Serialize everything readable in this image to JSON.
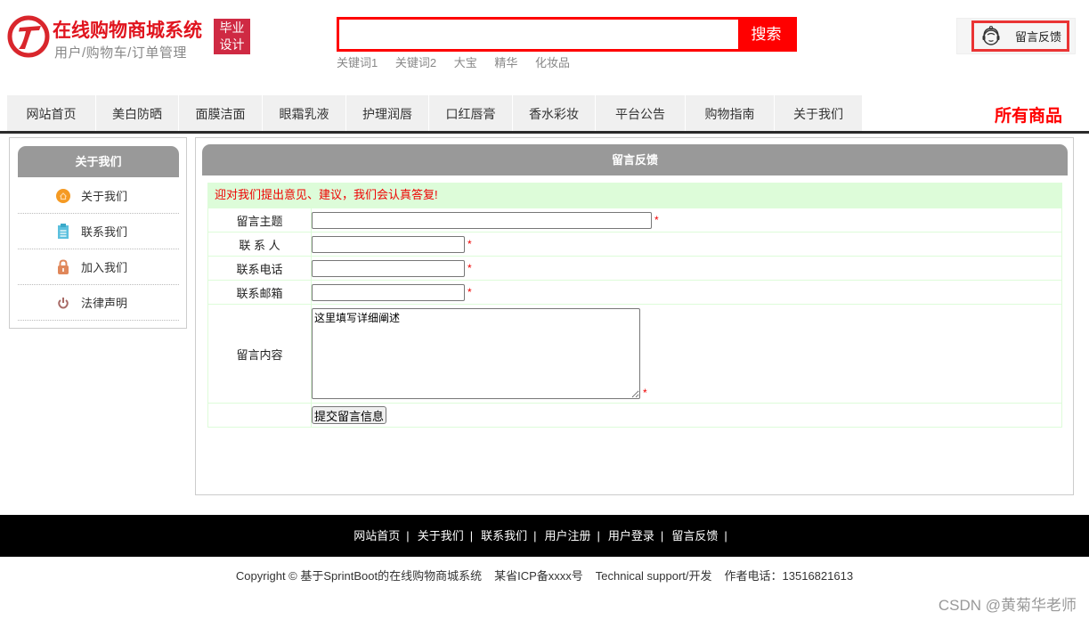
{
  "header": {
    "site_title": "在线购物商城系统",
    "site_subtitle": "用户/购物车/订单管理",
    "badge_line1": "毕业",
    "badge_line2": "设计",
    "search": {
      "value": "",
      "placeholder": "",
      "button_label": "搜索",
      "keywords": [
        "关键词1",
        "关键词2",
        "大宝",
        "精华",
        "化妆品"
      ]
    },
    "feedback_label": "留言反馈"
  },
  "nav": {
    "items": [
      "网站首页",
      "美白防晒",
      "面膜洁面",
      "眼霜乳液",
      "护理润唇",
      "口红唇膏",
      "香水彩妆",
      "平台公告",
      "购物指南",
      "关于我们"
    ],
    "all_products": "所有商品"
  },
  "sidebar": {
    "title": "关于我们",
    "items": [
      {
        "label": "关于我们",
        "icon": "home-icon"
      },
      {
        "label": "联系我们",
        "icon": "clipboard-icon"
      },
      {
        "label": "加入我们",
        "icon": "lock-icon"
      },
      {
        "label": "法律声明",
        "icon": "power-icon"
      }
    ]
  },
  "main": {
    "title": "留言反馈",
    "notice": "迎对我们提出意见、建议，我们会认真答复!",
    "fields": {
      "subject": {
        "label": "留言主题",
        "value": ""
      },
      "contact": {
        "label": "联 系 人",
        "value": ""
      },
      "phone": {
        "label": "联系电话",
        "value": ""
      },
      "email": {
        "label": "联系邮箱",
        "value": ""
      },
      "content": {
        "label": "留言内容",
        "value": "这里填写详细阐述"
      }
    },
    "required_mark": "*",
    "submit_label": "提交留言信息"
  },
  "footer": {
    "links": [
      "网站首页",
      "关于我们",
      "联系我们",
      "用户注册",
      "用户登录",
      "留言反馈"
    ],
    "separator": "|",
    "copyright": "Copyright © 基于SprintBoot的在线购物商城系统",
    "icp": "某省ICP备xxxx号",
    "support": "Technical support/开发",
    "phone": "作者电话：13516821613"
  },
  "watermark": "CSDN @黄菊华老师",
  "colors": {
    "brand_red": "#e0141e",
    "search_red": "#ff0000",
    "panel_gray": "#999999",
    "notice_green": "#ddfcd9",
    "footer_black": "#000000"
  }
}
